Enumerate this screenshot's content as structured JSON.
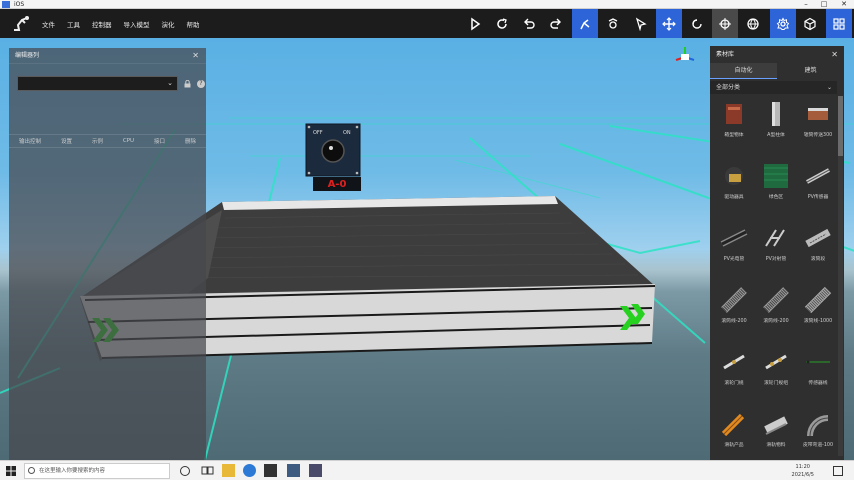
{
  "window": {
    "title": "iOS"
  },
  "toolbar": {
    "menu": [
      "文件",
      "工具",
      "控制器",
      "导入模型",
      "演化",
      "帮助"
    ]
  },
  "left_panel": {
    "title": "编辑器列",
    "select_value": "",
    "columns": [
      "输出控制",
      "设置",
      "示例",
      "CPU",
      "接口",
      "删除"
    ]
  },
  "scene": {
    "switch_off": "OFF",
    "switch_on": "ON",
    "switch_label": "A-0"
  },
  "right_panel": {
    "title": "素材库",
    "tabs": [
      "自动化",
      "建筑"
    ],
    "category": "全部分类",
    "items": [
      {
        "label": "箱型物体"
      },
      {
        "label": "A型柱体"
      },
      {
        "label": "辊筒传送300"
      },
      {
        "label": "驱动器具"
      },
      {
        "label": "绿色区"
      },
      {
        "label": "PV传感器"
      },
      {
        "label": "PV光电管"
      },
      {
        "label": "PV对射管"
      },
      {
        "label": "滚筒段"
      },
      {
        "label": "滚筒线-200"
      },
      {
        "label": "滚筒线-200"
      },
      {
        "label": "滚筒线-1000"
      },
      {
        "label": "滚轮门规"
      },
      {
        "label": "滚轮门规组"
      },
      {
        "label": "传感器线"
      },
      {
        "label": "滑轨产品"
      },
      {
        "label": "滑轨物料"
      },
      {
        "label": "皮带弯道-100"
      }
    ]
  },
  "taskbar": {
    "search_placeholder": "在这里输入你要搜索的内容",
    "time": "11:20",
    "date": "2021/6/5"
  },
  "colors": {
    "accent": "#2d64d8",
    "toolbar_bg": "#1c1c1c",
    "grid_line": "#2de3c4",
    "chevron": "#27d11f",
    "switch_label": "#e02020"
  }
}
